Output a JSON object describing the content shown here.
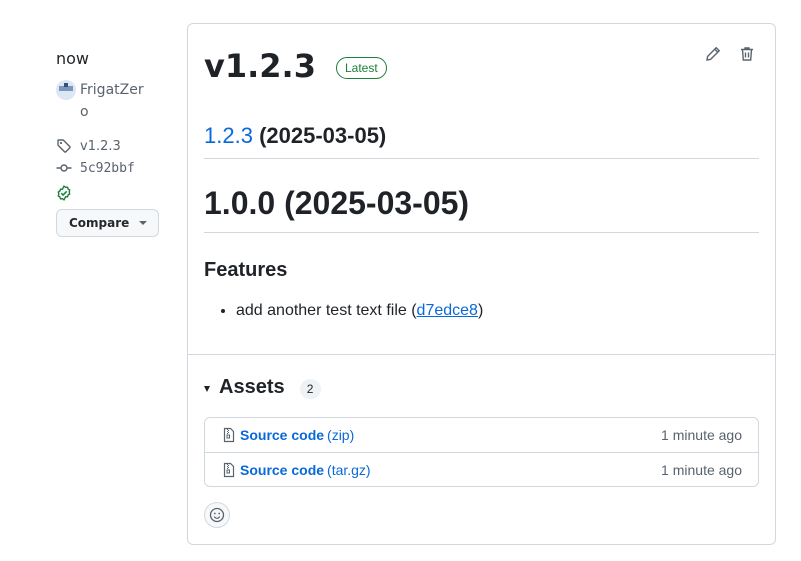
{
  "sidebar": {
    "relative_time": "now",
    "author": "FrigatZero",
    "tag": "v1.2.3",
    "commit": "5c92bbf",
    "compare_label": "Compare"
  },
  "release": {
    "title": "v1.2.3",
    "badge": "Latest",
    "version_link": "1.2.3",
    "version_date": "(2025-03-05)",
    "heading_main": "1.0.0 (2025-03-05)",
    "features_heading": "Features",
    "features": [
      {
        "text": "add another test text file (",
        "commit": "d7edce8",
        "suffix": ")"
      }
    ]
  },
  "assets": {
    "title": "Assets",
    "count": "2",
    "items": [
      {
        "name": "Source code",
        "ext": "(zip)",
        "time": "1 minute ago"
      },
      {
        "name": "Source code",
        "ext": "(tar.gz)",
        "time": "1 minute ago"
      }
    ]
  },
  "colors": {
    "link": "#0969da",
    "latest_green": "#1a7f37",
    "border": "#d1d9e0",
    "muted": "#59636e"
  },
  "icons": [
    "tag-icon",
    "commit-icon",
    "verified-icon",
    "pencil-icon",
    "trash-icon",
    "file-zip-icon",
    "smiley-icon"
  ]
}
